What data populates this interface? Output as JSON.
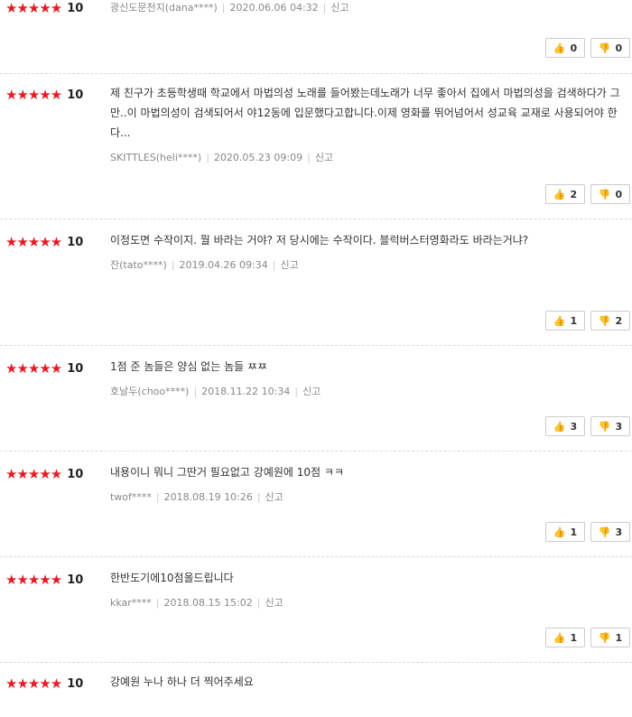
{
  "reviews": [
    {
      "stars": "★★★★★",
      "score": "10",
      "text": "",
      "author": "광신도문천지(dana****)",
      "date": "2020.06.06 04:32",
      "report": "신고",
      "like": "0",
      "dislike": "0"
    },
    {
      "stars": "★★★★★",
      "score": "10",
      "text": "제 친구가 초등학생때 학교에서 마법의성 노래를 들어봤는데노래가 너무 좋아서 집에서 마법의성을 검색하다가 그만..이 마법의성이 검색되어서 야12동에 입문했다고합니다.이제 영화를 뛰어넘어서 성교육 교재로 사용되어야 한다...",
      "author": "SKITTLES(heli****)",
      "date": "2020.05.23 09:09",
      "report": "신고",
      "like": "2",
      "dislike": "0"
    },
    {
      "stars": "★★★★★",
      "score": "10",
      "text": "이정도면 수작이지. 뭘 바라는 거야? 저 당시에는 수작이다. 블럭버스터영화라도 바라는거냐?",
      "author": "잔(tato****)",
      "date": "2019.04.26 09:34",
      "report": "신고",
      "like": "1",
      "dislike": "2"
    },
    {
      "stars": "★★★★★",
      "score": "10",
      "text": "1점 준 놈들은 양심 없는 놈들 ㅉㅉ",
      "author": "호날두(choo****)",
      "date": "2018.11.22 10:34",
      "report": "신고",
      "like": "3",
      "dislike": "3"
    },
    {
      "stars": "★★★★★",
      "score": "10",
      "text": "내용이니 뭐니 그딴거 필요없고 강예원에 10점 ㅋㅋ",
      "author": "twof****",
      "date": "2018.08.19 10:26",
      "report": "신고",
      "like": "1",
      "dislike": "3"
    },
    {
      "stars": "★★★★★",
      "score": "10",
      "text": "한반도기에10점올드립니다",
      "author": "kkar****",
      "date": "2018.08.15 15:02",
      "report": "신고",
      "like": "1",
      "dislike": "1"
    },
    {
      "stars": "★★★★★",
      "score": "10",
      "text": "강예원 누나 하나 더 찍어주세요"
    }
  ],
  "icons": {
    "like": "thumbs-up-icon",
    "dislike": "thumbs-down-icon",
    "star": "star-icon"
  },
  "colors": {
    "star": "#e51b23",
    "meta": "#888888",
    "border": "#cccccc"
  }
}
